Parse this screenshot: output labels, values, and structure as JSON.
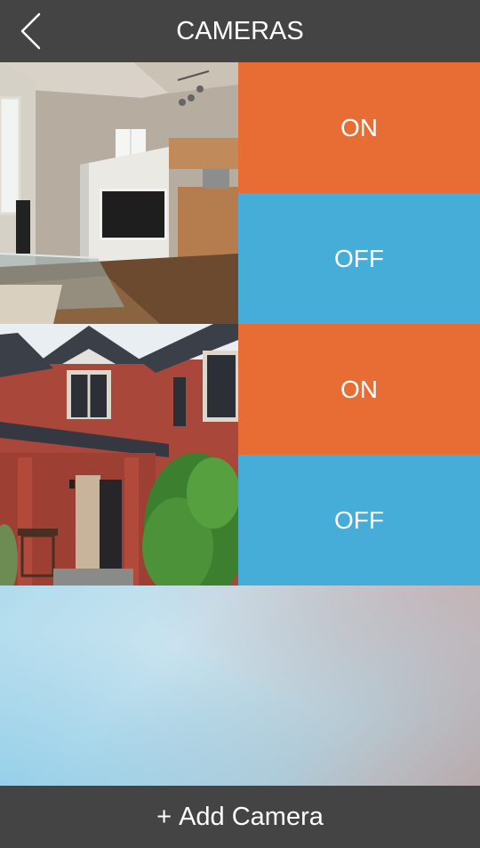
{
  "header": {
    "title": "CAMERAS",
    "back_icon": "chevron-left-icon"
  },
  "cameras": [
    {
      "thumbnail_subject": "living-room-interior",
      "on_label": "ON",
      "off_label": "OFF"
    },
    {
      "thumbnail_subject": "brick-house-exterior",
      "on_label": "ON",
      "off_label": "OFF"
    }
  ],
  "footer": {
    "plus_symbol": "+",
    "add_label": "Add Camera"
  },
  "colors": {
    "bar": "#444444",
    "on": "#e76d35",
    "off": "#46acd8",
    "text": "#ffffff"
  }
}
